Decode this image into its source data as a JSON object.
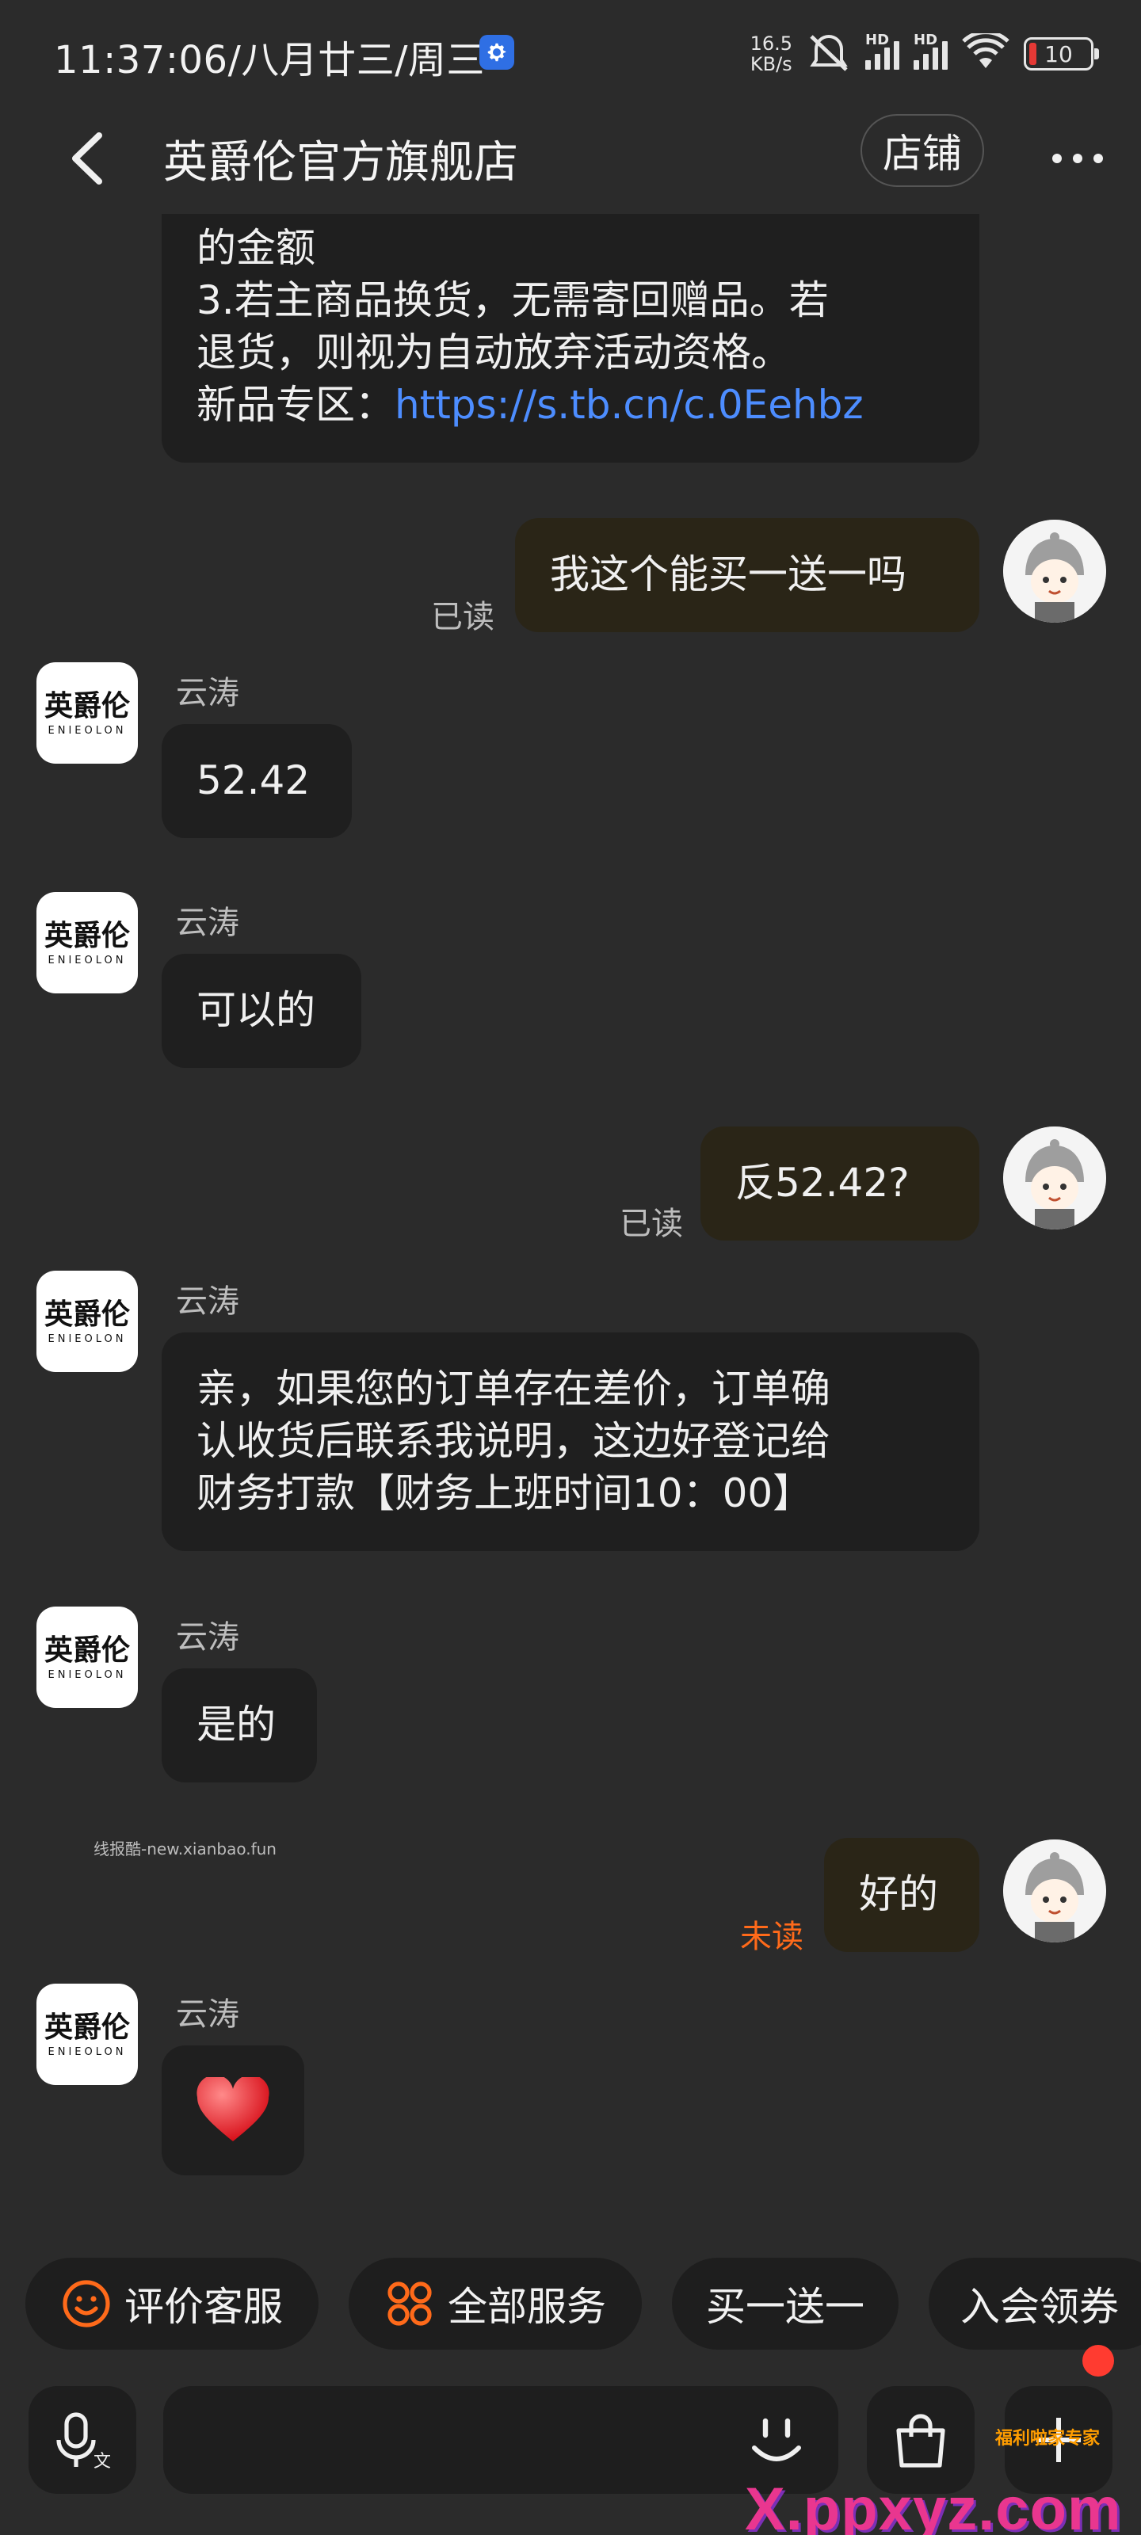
{
  "status_bar": {
    "time": "11:37:06/八月廿三/周三",
    "speed_value": "16.5",
    "speed_unit": "KB/s",
    "sim1_label": "HD",
    "sim2_label": "HD",
    "battery": "10"
  },
  "header": {
    "title": "英爵伦官方旗舰店",
    "shop_button": "店铺"
  },
  "shop_avatar": {
    "cn": "英爵伦",
    "en": "ENIEOLON"
  },
  "messages": {
    "m0_line1": "的金额",
    "m0_line2": "3.若主商品换货，无需寄回赠品。若",
    "m0_line3": "退货，则视为自动放弃活动资格。",
    "m0_line4_prefix": "新品专区：",
    "m0_link": "https://s.tb.cn/c.0Eehbz",
    "m1_text": "我这个能买一送一吗",
    "m1_status": "已读",
    "m2_sender": "云涛",
    "m2_text": "52.42",
    "m3_sender": "云涛",
    "m3_text": "可以的",
    "m4_text": "反52.42?",
    "m4_status": "已读",
    "m5_sender": "云涛",
    "m5_line1": "亲，如果您的订单存在差价，订单确",
    "m5_line2": "认收货后联系我说明，这边好登记给",
    "m5_line3": "财务打款【财务上班时间10：00】",
    "m6_sender": "云涛",
    "m6_text": "是的",
    "m7_text": "好的",
    "m7_status": "未读",
    "m8_sender": "云涛",
    "m8_emoji": "heart-icon"
  },
  "watermark_small": "线报酷-new.xianbao.fun",
  "chips": {
    "c1": "评价客服",
    "c2": "全部服务",
    "c3": "买一送一",
    "c4": "入会领券"
  },
  "input": {
    "placeholder": ""
  },
  "brand_watermark": {
    "main": "X.ppxyz.com",
    "sub": "x.ppxyz.com",
    "tag": "福利啦家专家"
  },
  "colors": {
    "accent_orange": "#ff6a1a",
    "link_blue": "#4d8dff",
    "unread_red": "#ff3b30"
  }
}
